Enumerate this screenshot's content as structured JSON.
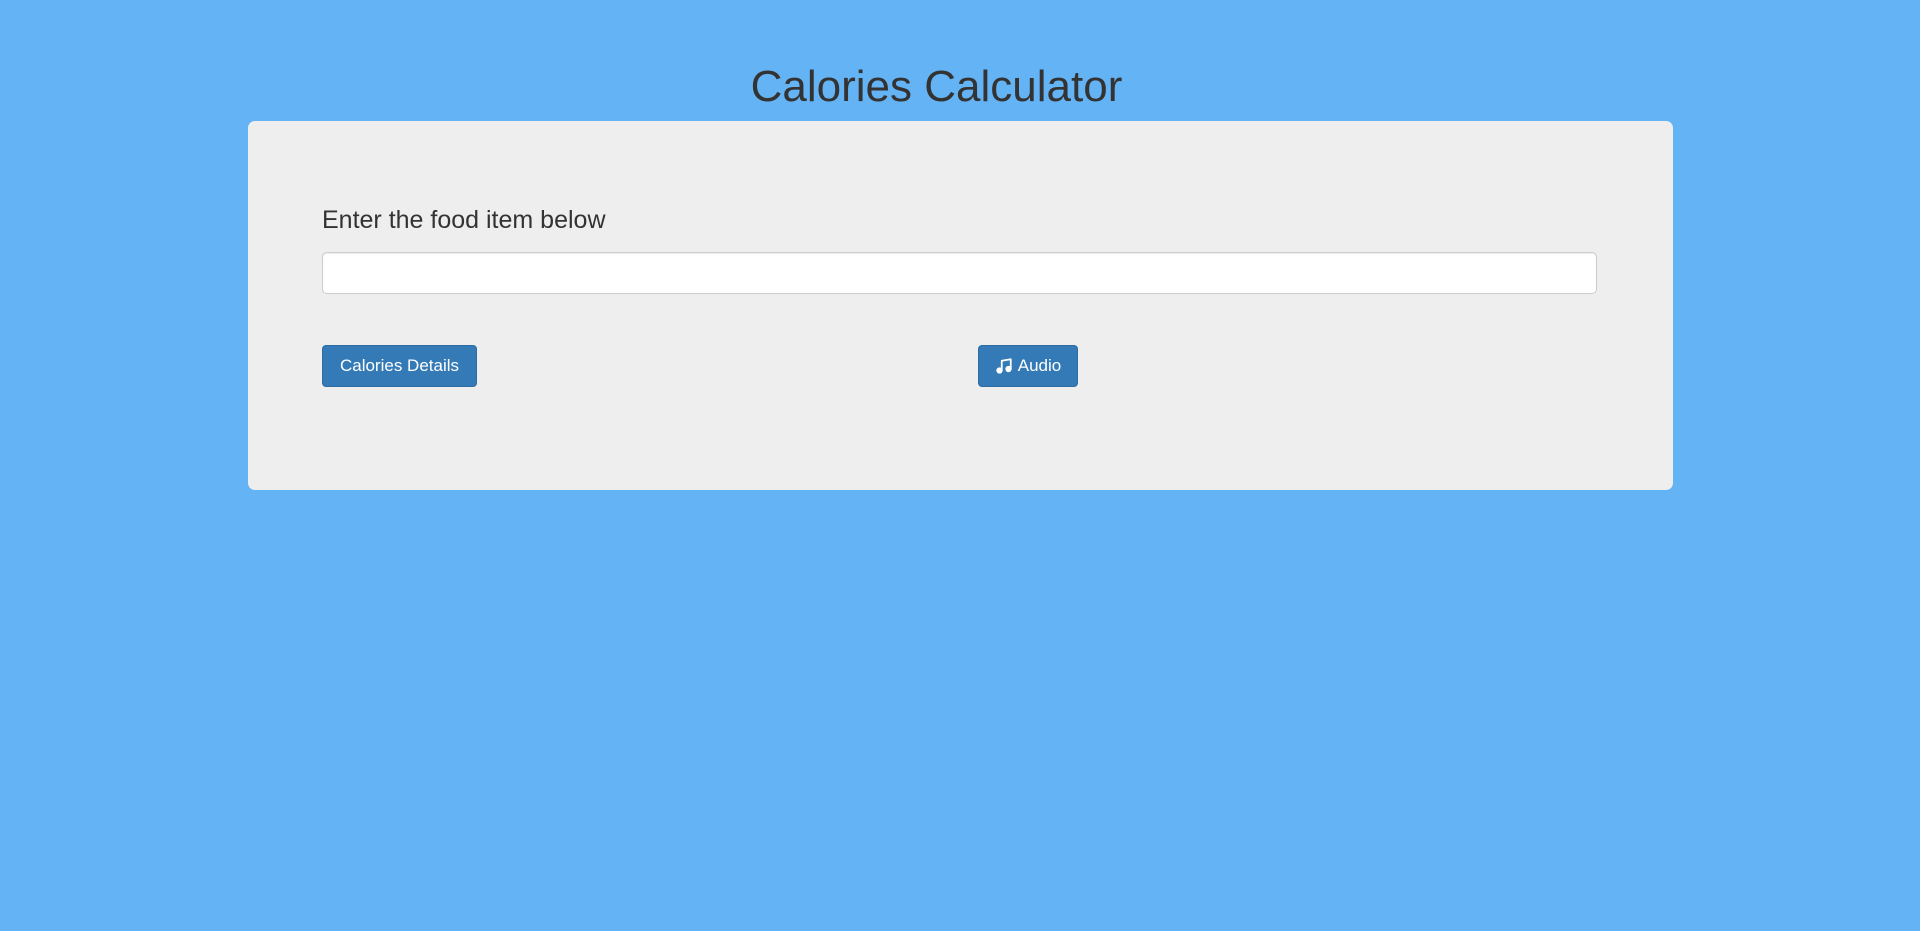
{
  "page": {
    "title": "Calories Calculator"
  },
  "form": {
    "label": "Enter the food item below",
    "food_input_value": "",
    "food_input_placeholder": ""
  },
  "buttons": {
    "calories_details_label": "Calories Details",
    "audio_label": "Audio",
    "audio_icon": "music-note-icon"
  },
  "colors": {
    "background": "#64b3f4",
    "panel": "#eeeeee",
    "primary_button": "#337ab7"
  }
}
